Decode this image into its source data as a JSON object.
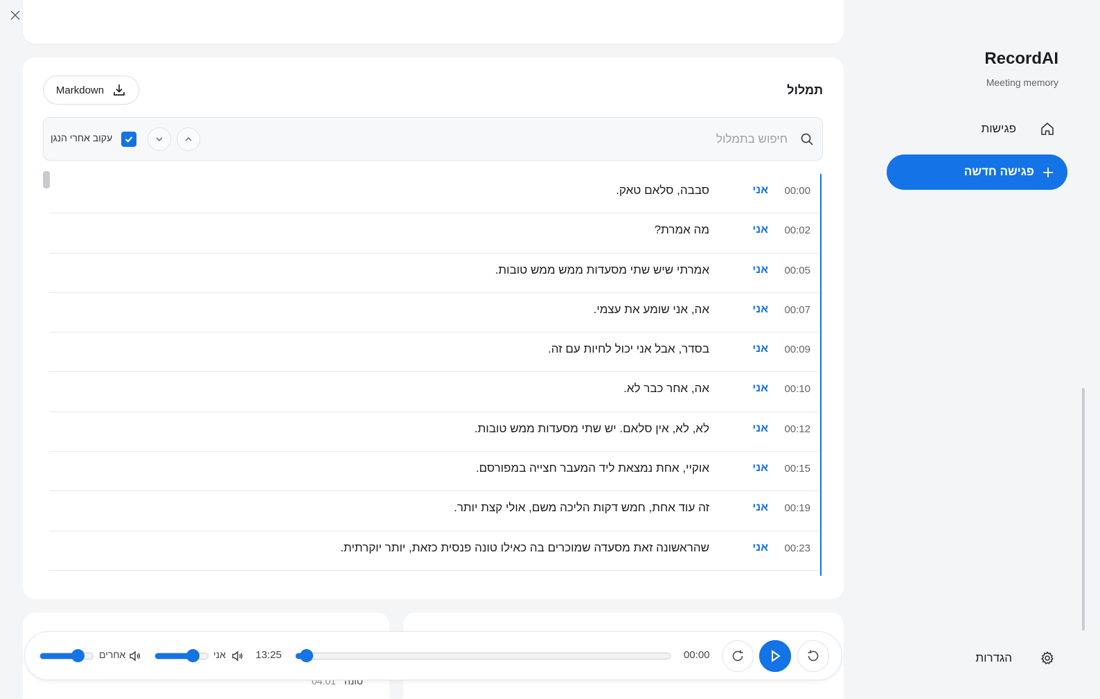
{
  "window": {
    "close_icon": "close-icon",
    "maximize_icon": "maximize-icon",
    "minimize_icon": "minimize-icon"
  },
  "sidebar": {
    "brand": "RecordAI",
    "subtitle": "Meeting memory",
    "nav_meetings": "פגישות",
    "new_meeting": "פגישה חדשה",
    "settings": "הגדרות"
  },
  "transcript": {
    "title": "תמלול",
    "export_label": "Markdown",
    "search_placeholder": "חיפוש בתמלול",
    "follow_label": "עקוב אחרי הנגן",
    "follow_checked": true,
    "rows": [
      {
        "time": "00:00",
        "speaker": "אני",
        "text": "סבבה, סלאם טאק."
      },
      {
        "time": "00:02",
        "speaker": "אני",
        "text": "מה אמרת?"
      },
      {
        "time": "00:05",
        "speaker": "אני",
        "text": "אמרתי שיש שתי מסעדות ממש ממש טובות."
      },
      {
        "time": "00:07",
        "speaker": "אני",
        "text": "אה, אני שומע את עצמי."
      },
      {
        "time": "00:09",
        "speaker": "אני",
        "text": "בסדר, אבל אני יכול לחיות עם זה."
      },
      {
        "time": "00:10",
        "speaker": "אני",
        "text": "אה, אחר כבר לא."
      },
      {
        "time": "00:12",
        "speaker": "אני",
        "text": "לא, לא, אין סלאם. יש שתי מסעדות ממש טובות."
      },
      {
        "time": "00:15",
        "speaker": "אני",
        "text": "אוקיי, אחת נמצאת ליד המעבר חצייה במפורסם."
      },
      {
        "time": "00:19",
        "speaker": "אני",
        "text": "זה עוד אחת, חמש דקות הליכה משם, אולי קצת יותר."
      },
      {
        "time": "00:23",
        "speaker": "אני",
        "text": "שהראשונה זאת מסעדה שמוכרים בה כאילו טונה פנסית כזאת, יותר יוקרתית."
      }
    ]
  },
  "bottom_peek": {
    "time": "04:01",
    "label": "טונה"
  },
  "player": {
    "current_time": "00:00",
    "total_time": "13:25",
    "progress": 0.03,
    "me_label": "אני",
    "me_volume": 0.7,
    "others_label": "אחרים",
    "others_volume": 0.7
  },
  "colors": {
    "accent": "#1473e6",
    "background": "#f4f5f7"
  }
}
